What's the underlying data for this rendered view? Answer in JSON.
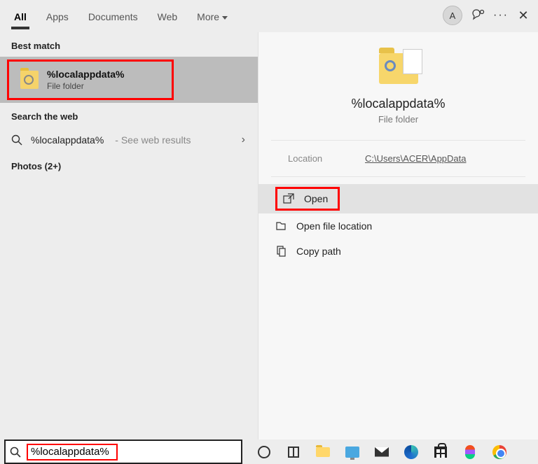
{
  "header": {
    "tabs": [
      "All",
      "Apps",
      "Documents",
      "Web",
      "More"
    ],
    "avatar_initial": "A"
  },
  "left": {
    "best_match_label": "Best match",
    "best_match": {
      "title": "%localappdata%",
      "subtitle": "File folder"
    },
    "search_web_label": "Search the web",
    "web_result": {
      "query": "%localappdata%",
      "suffix": " - See web results"
    },
    "photos_label": "Photos (2+)"
  },
  "right": {
    "title": "%localappdata%",
    "subtitle": "File folder",
    "location_label": "Location",
    "location_value": "C:\\Users\\ACER\\AppData",
    "actions": {
      "open": "Open",
      "open_loc": "Open file location",
      "copy": "Copy path"
    }
  },
  "search": {
    "value": "%localappdata%"
  }
}
